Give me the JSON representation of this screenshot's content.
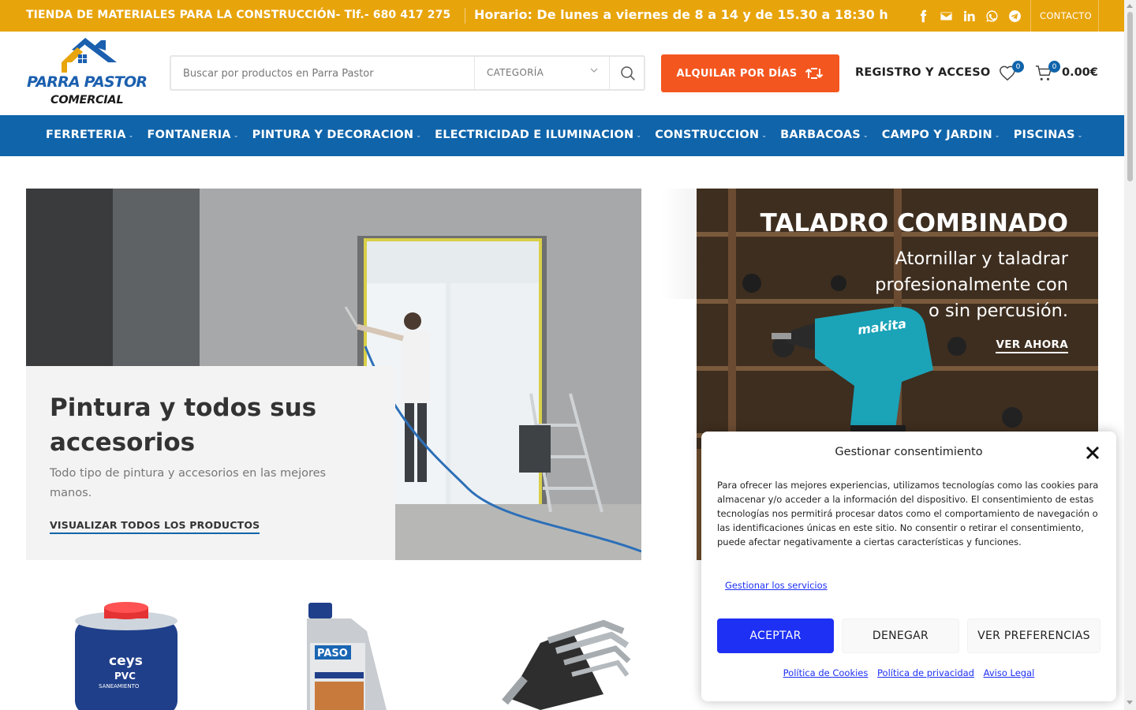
{
  "topbar": {
    "store_text": "TIENDA DE MATERIALES PARA LA CONSTRUCCIÓN- Tlf.- 680 417 275",
    "hours_text": "Horario: De lunes a viernes de 8 a 14 y de 15.30 a 18:30 h",
    "social_icons": [
      "facebook-icon",
      "email-icon",
      "linkedin-icon",
      "whatsapp-icon",
      "telegram-icon"
    ],
    "contact_label": "CONTACTO"
  },
  "header": {
    "logo_line1": "PARRA PASTOR",
    "logo_line2": "COMERCIAL",
    "search_placeholder": "Buscar por productos en Parra Pastor",
    "category_label": "CATEGORÍA",
    "rent_button": "ALQUILAR POR DÍAS",
    "login_label": "REGISTRO Y ACCESO",
    "wishlist_count": "0",
    "cart_count": "0",
    "cart_total": "0.00€"
  },
  "nav": {
    "items": [
      "FERRETERIA",
      "FONTANERIA",
      "PINTURA Y DECORACION",
      "ELECTRICIDAD E ILUMINACION",
      "CONSTRUCCION",
      "BARBACOAS",
      "CAMPO Y JARDIN",
      "PISCINAS"
    ]
  },
  "hero": {
    "title": "Pintura y todos sus accesorios",
    "text": "Todo tipo de pintura y accesorios en las mejores manos.",
    "link": "VISUALIZAR TODOS LOS PRODUCTOS"
  },
  "promo": {
    "title": "TALADRO COMBINADO",
    "text": "Atornillar y taladrar profesionalmente con o sin percusión.",
    "link": "VER AHORA"
  },
  "cookie": {
    "title": "Gestionar consentimiento",
    "body": "Para ofrecer las mejores experiencias, utilizamos tecnologías como las cookies para almacenar y/o acceder a la información del dispositivo. El consentimiento de estas tecnologías nos permitirá procesar datos como el comportamiento de navegación o las identificaciones únicas en este sitio. No consentir o retirar el consentimiento, puede afectar negativamente a ciertas características y funciones.",
    "manage_link": "Gestionar los servicios",
    "accept": "ACEPTAR",
    "deny": "DENEGAR",
    "preferences": "VER PREFERENCIAS",
    "links": [
      "Política de Cookies",
      "Política de privacidad",
      "Aviso Legal"
    ]
  },
  "colors": {
    "topbar": "#e8a40b",
    "nav": "#0f64aa",
    "rent_button": "#f4561f",
    "cookie_accent": "#1e30f3"
  }
}
